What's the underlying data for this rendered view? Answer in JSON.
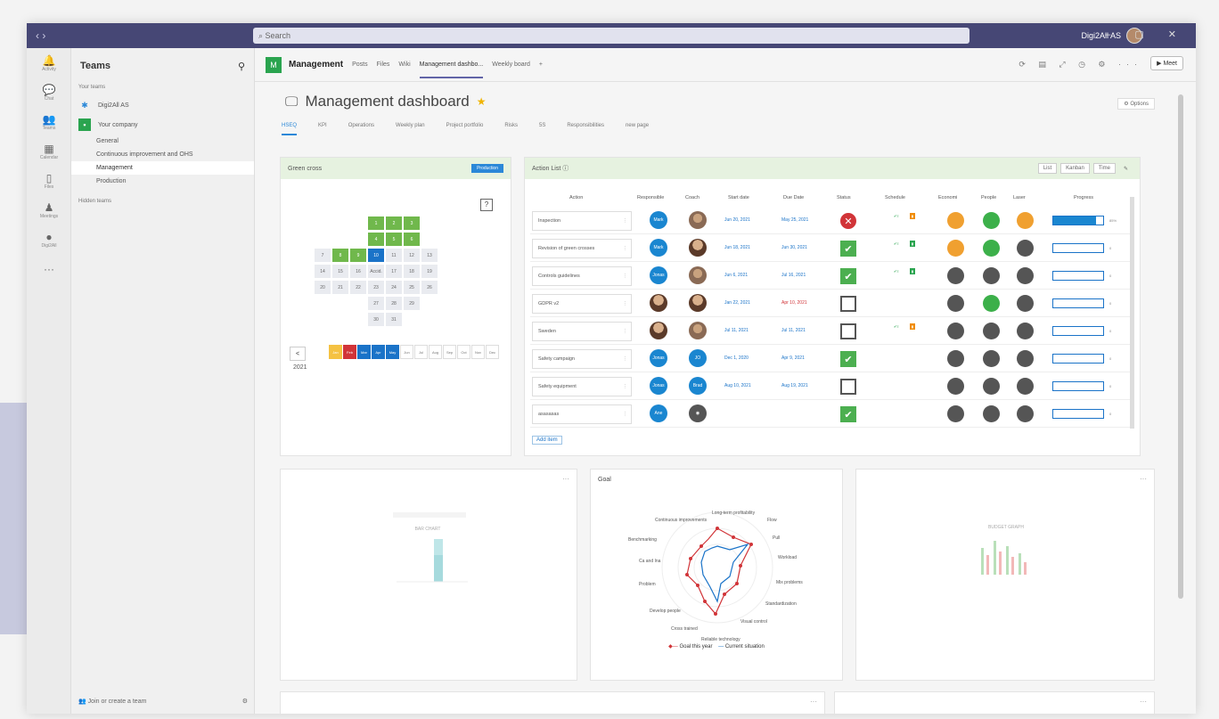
{
  "titlebar": {
    "search_placeholder": "Search",
    "user_name": "Digi2All AS"
  },
  "rail": [
    {
      "icon": "activity-icon",
      "label": "Activity"
    },
    {
      "icon": "chat-icon",
      "label": "Chat"
    },
    {
      "icon": "teams-icon",
      "label": "Teams"
    },
    {
      "icon": "calendar-icon",
      "label": "Calendar"
    },
    {
      "icon": "files-icon",
      "label": "Files"
    },
    {
      "icon": "meetings-icon",
      "label": "Meetings"
    },
    {
      "icon": "digi2all-icon",
      "label": "Digi2All"
    }
  ],
  "teams_panel": {
    "title": "Teams",
    "section": "Your teams",
    "team1": "Digi2All AS",
    "team2": "Your company",
    "channels": [
      "General",
      "Continuous improvement and OHS",
      "Management",
      "Production"
    ],
    "hidden": "Hidden teams",
    "join": "Join or create a team"
  },
  "channel_header": {
    "badge": "M",
    "title": "Management",
    "tabs": [
      "Posts",
      "Files",
      "Wiki",
      "Management dashbo...",
      "Weekly board"
    ],
    "add": "+",
    "meet": "Meet"
  },
  "dashboard": {
    "title": "Management dashboard",
    "options": "Options",
    "tabs": [
      "HSEQ",
      "KPI",
      "Operations",
      "Weekly plan",
      "Project portfolio",
      "Risks",
      "5S",
      "Responsibilities",
      "new page"
    ]
  },
  "green_cross": {
    "title": "Green cross",
    "badge": "Production",
    "help": "?",
    "year": "2021",
    "prev": "<",
    "months": [
      "Jan",
      "Feb",
      "Mar",
      "Apr",
      "May",
      "Jun",
      "Jul",
      "Aug",
      "Sep",
      "Oct",
      "Nov",
      "Dec"
    ],
    "days": {
      "r1": [
        "1",
        "2",
        "3"
      ],
      "r2": [
        "4",
        "5",
        "6"
      ],
      "r3": [
        "7",
        "8",
        "9",
        "10",
        "11",
        "12",
        "13"
      ],
      "r4": [
        "14",
        "15",
        "16",
        "Accid.",
        "17",
        "18",
        "19"
      ],
      "r5": [
        "20",
        "21",
        "22",
        "23",
        "24",
        "25",
        "26"
      ],
      "r6": [
        "27",
        "28",
        "29"
      ],
      "r7": [
        "30",
        "31"
      ]
    }
  },
  "action_list": {
    "title": "Action List",
    "views": [
      "List",
      "Kanban",
      "Time"
    ],
    "columns": [
      "Action",
      "Responsible",
      "Coach",
      "Start date",
      "Due Date",
      "Status",
      "Schedule",
      "Economi",
      "People",
      "Laser",
      "Progress"
    ],
    "rows": [
      {
        "action": "Inspection",
        "resp": "Mark",
        "start": "Jun 20, 2021",
        "due": "May 25, 2021",
        "status": "x",
        "sched": "orange",
        "progress": 0.85,
        "prog_label": "85%"
      },
      {
        "action": "Revision of green crosses",
        "resp": "Mark",
        "start": "Jun 18, 2021",
        "due": "Jun 30, 2021",
        "status": "ok",
        "sched": "green",
        "progress": 0,
        "prog_label": "0"
      },
      {
        "action": "Controls guidelines",
        "resp": "Jonas",
        "start": "Jun 6, 2021",
        "due": "Jul 16, 2021",
        "status": "ok",
        "sched": "green",
        "progress": 0,
        "prog_label": "0"
      },
      {
        "action": "GDPR v2",
        "resp": "",
        "start": "Jan 22, 2021",
        "due": "Apr 10, 2021",
        "status": "empty",
        "sched": "",
        "progress": 0,
        "prog_label": "0"
      },
      {
        "action": "Sweden",
        "resp": "",
        "start": "Jul 11, 2021",
        "due": "Jul 11, 2021",
        "status": "empty",
        "sched": "orange",
        "progress": 0,
        "prog_label": "0"
      },
      {
        "action": "Safety campaign",
        "resp": "Jonas",
        "start": "Dec 1, 2020",
        "due": "Apr 9, 2021",
        "status": "ok",
        "sched": "",
        "progress": 0,
        "prog_label": "0"
      },
      {
        "action": "Safety equipment",
        "resp": "Jonas",
        "start": "Aug 10, 2021",
        "due": "Aug 19, 2021",
        "status": "empty",
        "sched": "",
        "progress": 0,
        "prog_label": "0"
      },
      {
        "action": "asasasas",
        "resp": "Ane",
        "start": "",
        "due": "",
        "status": "ok",
        "sched": "",
        "progress": 0,
        "prog_label": "0"
      }
    ],
    "add_item": "Add item",
    "colors": {
      "orange": "#f0a030",
      "green": "#3cb04a",
      "grey": "#555555"
    }
  },
  "bottom": {
    "card1_title": "BAR CHART",
    "card2_title": "Goal",
    "card3_title": "BUDGET GRAPH",
    "radar_labels": [
      "Long-term profitability",
      "Flow",
      "Pull",
      "Workload",
      "Mix problems",
      "Standardization",
      "Visual control",
      "Reliable technology",
      "Cross trained",
      "Develop people",
      "Problem",
      "Ca and Ina",
      "Benchmarking",
      "Continuous improvements"
    ],
    "legend_goal": "Goal this year",
    "legend_current": "Current situation"
  }
}
